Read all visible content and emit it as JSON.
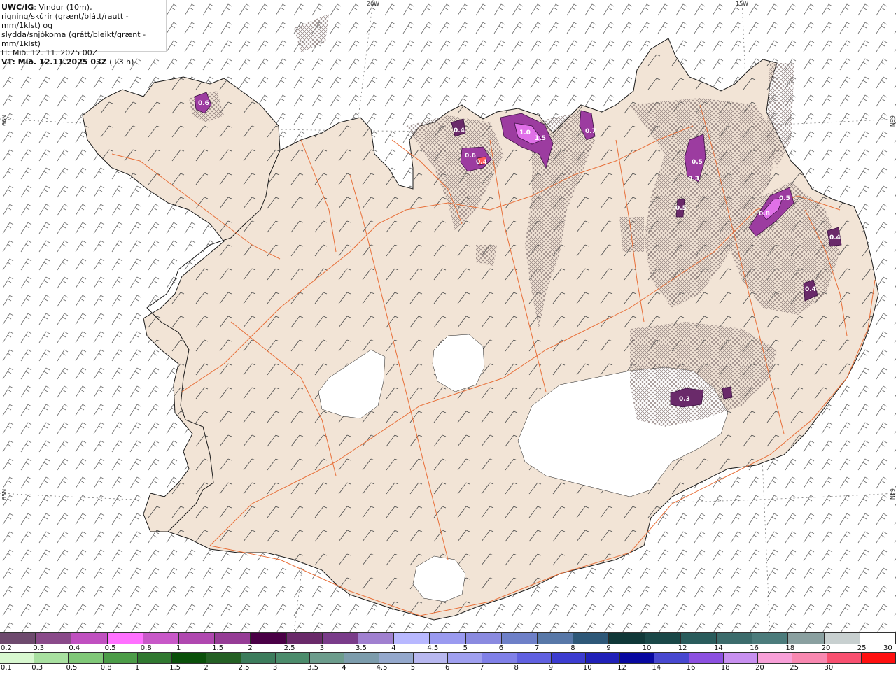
{
  "header": {
    "model": "UWC/IG",
    "line1_rest": ": Vindur (10m),",
    "line2": "rigning/skúrir (grænt/blátt/rautt - mm/1klst) og",
    "line3": "slydda/snjókoma (grátt/bleikt/grænt - mm/1klst)",
    "line4": "IT: Mið. 12. 11. 2025 00Z",
    "line5_bold": "VT: Mið. 12.11.2025 03Z",
    "line5_rest": " (+3 h)"
  },
  "graticule": {
    "top_labels": [
      "20W",
      "15W"
    ],
    "left_labels": [
      "66N",
      "65N"
    ],
    "right_labels": [
      "66N",
      "64N"
    ]
  },
  "precip_labels": [
    "0.6",
    "0.4",
    "0.6",
    "0.4",
    "1.0",
    "1.5",
    "0.7",
    "0.5",
    "0.3",
    "0.5",
    "0.8",
    "0.5",
    "0.4",
    "0.4",
    "0.3"
  ],
  "legend_snow": {
    "colors": [
      "#6e4a6e",
      "#8a4a8a",
      "#c050c0",
      "#ff70ff",
      "#c858c8",
      "#b048b0",
      "#963c96",
      "#4a0046",
      "#6a2a6a",
      "#7a3c8a",
      "#a080d0",
      "#b8b8ff",
      "#9a9af0",
      "#8a8ae0",
      "#6e80c8",
      "#5878a8",
      "#2e5878",
      "#103838",
      "#1a4848",
      "#2a5c5c",
      "#3c6c6c",
      "#4c7c7c",
      "#8aa0a0",
      "#c8d0d0",
      "#ffffff"
    ],
    "labels": [
      "0.2",
      "0.3",
      "0.4",
      "0.5",
      "0.8",
      "1",
      "1.5",
      "2",
      "2.5",
      "3",
      "3.5",
      "4",
      "4.5",
      "5",
      "6",
      "7",
      "8",
      "9",
      "10",
      "12",
      "14",
      "16",
      "18",
      "20",
      "25",
      "30"
    ]
  },
  "legend_rain": {
    "colors": [
      "#d8f8d0",
      "#a8e0a0",
      "#80c878",
      "#4c9c48",
      "#307830",
      "#0a500a",
      "#246024",
      "#3c7c5c",
      "#4c8c6c",
      "#6c9c8c",
      "#7c9cac",
      "#94a8cc",
      "#b8b8f0",
      "#a0a0f0",
      "#8080e8",
      "#6060e0",
      "#3c3cd0",
      "#2020b8",
      "#0808a0",
      "#4848d0",
      "#8c50e0",
      "#c890f0",
      "#f8a0d8",
      "#f888b0",
      "#f85070",
      "#ff1010"
    ],
    "labels": [
      "0.1",
      "0.3",
      "0.5",
      "0.8",
      "1",
      "1.5",
      "2",
      "2.5",
      "3",
      "3.5",
      "4",
      "4.5",
      "5",
      "6",
      "7",
      "8",
      "9",
      "10",
      "12",
      "14",
      "16",
      "18",
      "20",
      "25",
      "30"
    ]
  },
  "colors": {
    "land": "#f2e4d6",
    "road": "#e8703a",
    "coast": "#1a1a1a",
    "glacier": "#ffffff",
    "snow_hatch": "#8a7a78",
    "precip_purple": "#9c3ca0"
  }
}
